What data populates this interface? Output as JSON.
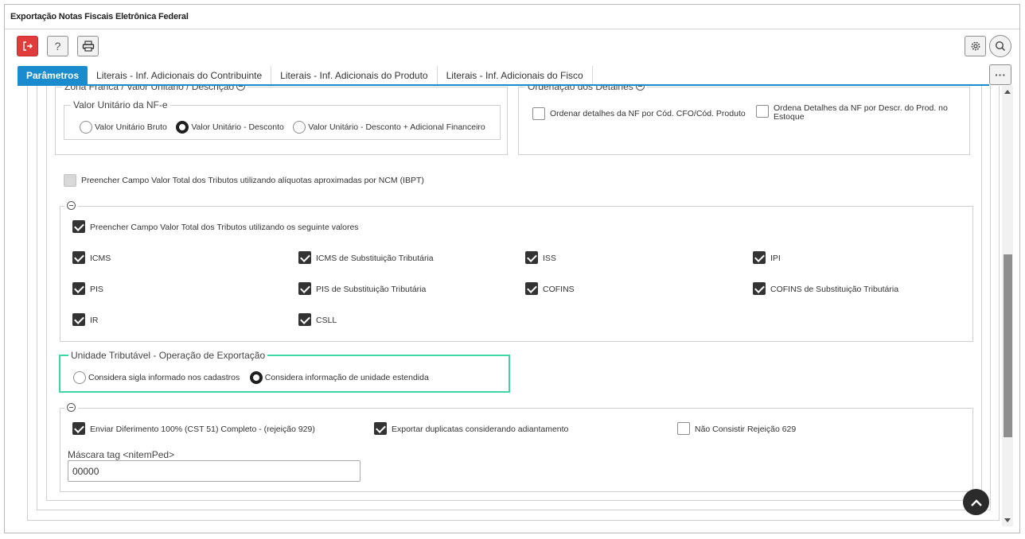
{
  "window": {
    "title": "Exportação Notas Fiscais Eletrônica Federal"
  },
  "toolbar": {
    "exit_icon": "exit-icon",
    "help_symbol": "?",
    "print_icon": "printer-icon",
    "settings_icon": "gear-icon",
    "search_icon": "search-icon",
    "more_symbol": "···"
  },
  "tabs": [
    {
      "label": "Parâmetros",
      "active": true
    },
    {
      "label": "Literais - Inf. Adicionais do Contribuinte",
      "active": false
    },
    {
      "label": "Literais - Inf. Adicionais do Produto",
      "active": false
    },
    {
      "label": "Literais - Inf. Adicionais do Fisco",
      "active": false
    }
  ],
  "zona_franca": {
    "legend": "Zona Franca / Valor Unitário / Descrição",
    "valor_unitario": {
      "legend": "Valor Unitário da NF-e",
      "options": [
        {
          "label": "Valor Unitário Bruto",
          "checked": false
        },
        {
          "label": "Valor Unitário - Desconto",
          "checked": true
        },
        {
          "label": "Valor Unitário - Desconto + Adicional Financeiro",
          "checked": false
        }
      ]
    }
  },
  "ordenacao": {
    "legend": "Ordenação dos Detalhes",
    "options": [
      {
        "label": "Ordenar detalhes da NF por Cód. CFO/Cód. Produto",
        "checked": false
      },
      {
        "label_line1": "Ordena Detalhes da NF por Descr. do Prod. no",
        "label_line2": "Estoque",
        "checked": false
      }
    ]
  },
  "ibpt": {
    "label": "Preencher Campo Valor Total dos Tributos utilizando alíquotas aproximadas por NCM (IBPT)",
    "checked": false,
    "disabled": true
  },
  "tributos": {
    "main_label": "Preencher Campo Valor Total dos Tributos utilizando os seguinte valores",
    "main_checked": true,
    "items": [
      {
        "label": "ICMS",
        "checked": true
      },
      {
        "label": "ICMS de Substituição Tributária",
        "checked": true
      },
      {
        "label": "ISS",
        "checked": true
      },
      {
        "label": "IPI",
        "checked": true
      },
      {
        "label": "PIS",
        "checked": true
      },
      {
        "label": "PIS de Substituição Tributária",
        "checked": true
      },
      {
        "label": "COFINS",
        "checked": true
      },
      {
        "label": "COFINS de Substituição Tributária",
        "checked": true
      },
      {
        "label": "IR",
        "checked": true
      },
      {
        "label": "CSLL",
        "checked": true
      }
    ]
  },
  "unidade": {
    "legend": "Unidade Tributável - Operação de Exportação",
    "highlight_color": "#3fd6a6",
    "options": [
      {
        "label": "Considera sigla informado nos cadastros",
        "checked": false
      },
      {
        "label": "Considera informação de unidade estendida",
        "checked": true
      }
    ]
  },
  "outros": {
    "items": [
      {
        "label": "Enviar Diferimento 100% (CST 51) Completo - (rejeição 929)",
        "checked": true
      },
      {
        "label": "Exportar duplicatas considerando adiantamento",
        "checked": true
      },
      {
        "label": "Não Consistir Rejeição 629",
        "checked": false
      }
    ],
    "mask_label": "Máscara tag <nitemPed>",
    "mask_value": "00000"
  },
  "colors": {
    "accent": "#1a8ccd",
    "exit": "#e13c3c"
  }
}
